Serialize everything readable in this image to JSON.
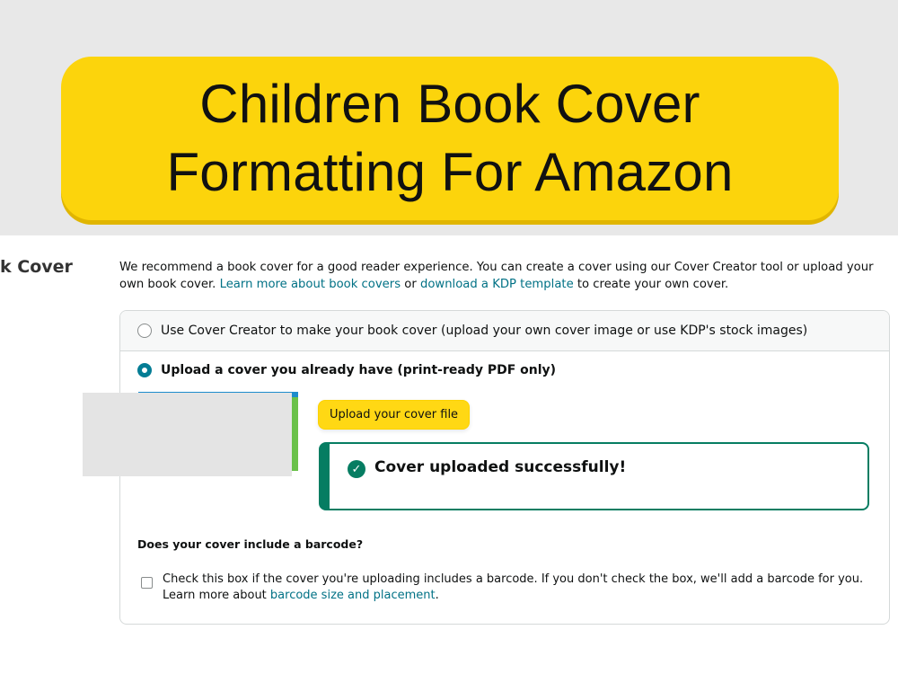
{
  "banner": {
    "title_line1": "Children Book Cover",
    "title_line2": "Formatting For Amazon",
    "accent_color": "#fcd40c"
  },
  "section": {
    "label": "k Cover",
    "intro_text": "We recommend a book cover for a good reader experience. You can create a cover using our Cover Creator tool or upload your own book cover. ",
    "link_book_covers": "Learn more about book covers",
    "or_text": " or ",
    "link_template": "download a KDP template",
    "intro_tail": " to create your own cover."
  },
  "options": {
    "cover_creator_label": "Use Cover Creator to make your book cover (upload your own cover image or use KDP's stock images)",
    "cover_creator_selected": false,
    "upload_label": "Upload a cover you already have (print-ready PDF only)",
    "upload_selected": true
  },
  "upload": {
    "button_label": "Upload your cover file",
    "success_icon": "check-circle-icon",
    "success_message": "Cover uploaded successfully!",
    "success_color": "#067d62"
  },
  "barcode": {
    "question": "Does your cover include a barcode?",
    "checked": false,
    "text": "Check this box if the cover you're uploading includes a barcode. If you don't check the box, we'll add a barcode for you.",
    "learn_more_prefix": "Learn more about ",
    "link": "barcode size and placement",
    "suffix": "."
  }
}
